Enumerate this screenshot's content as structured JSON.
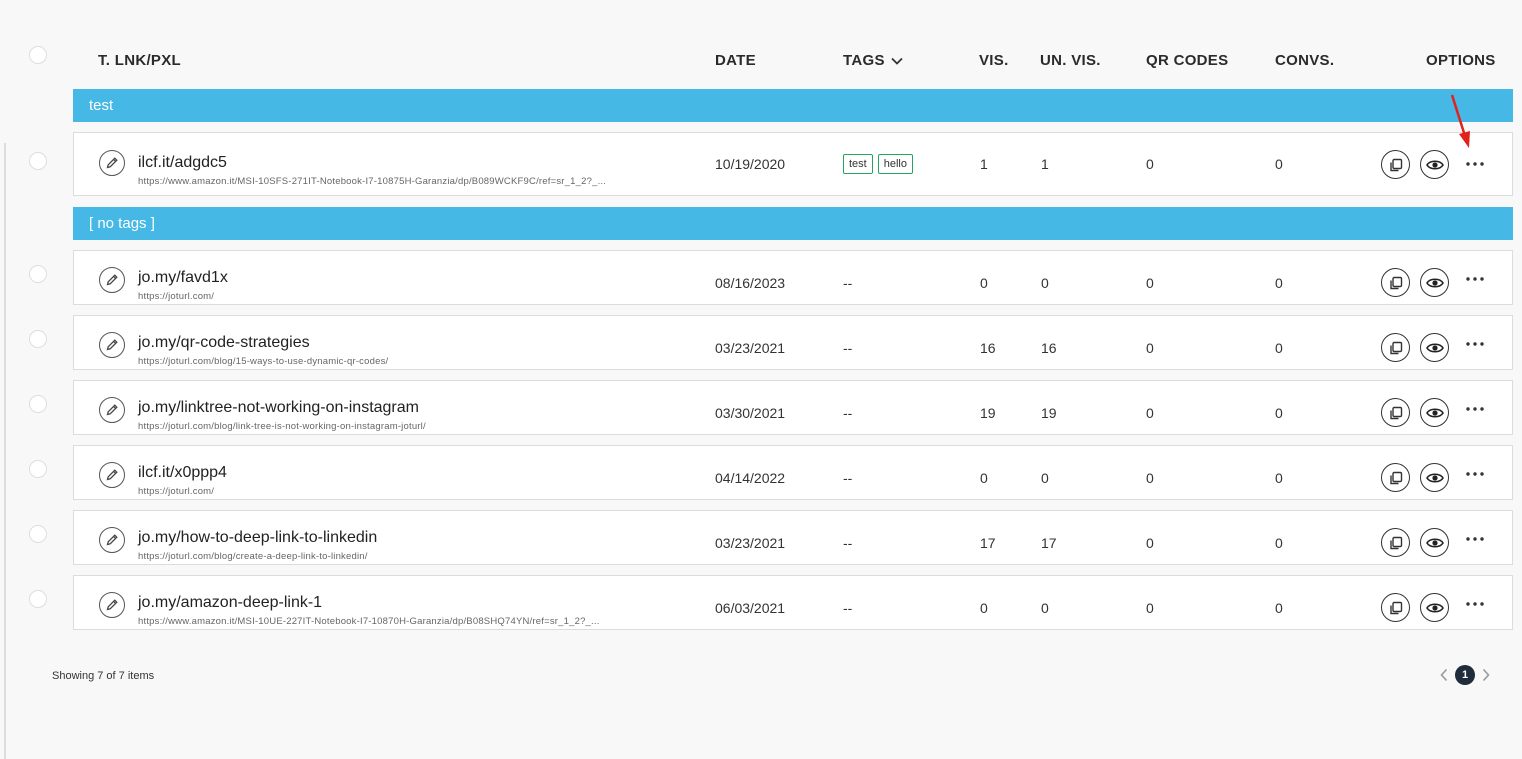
{
  "columns": {
    "link": "T. LNK/PXL",
    "date": "DATE",
    "tags": "TAGS",
    "visits": "VIS.",
    "unique_visits": "UN. VIS.",
    "qr_codes": "QR CODES",
    "conversions": "CONVS.",
    "options": "OPTIONS"
  },
  "groups": [
    {
      "label": "test",
      "rows": [
        {
          "name": "ilcf.it/adgdc5",
          "url": "https://www.amazon.it/MSI-10SFS-271IT-Notebook-I7-10875H-Garanzia/dp/B089WCKF9C/ref=sr_1_2?_...",
          "date": "10/19/2020",
          "tags": [
            "test",
            "hello"
          ],
          "tags_text": "",
          "vis": "1",
          "unvis": "1",
          "qr": "0",
          "conv": "0"
        }
      ]
    },
    {
      "label": "[ no tags ]",
      "rows": [
        {
          "name": "jo.my/favd1x",
          "url": "https://joturl.com/",
          "date": "08/16/2023",
          "tags_text": "--",
          "vis": "0",
          "unvis": "0",
          "qr": "0",
          "conv": "0"
        },
        {
          "name": "jo.my/qr-code-strategies",
          "url": "https://joturl.com/blog/15-ways-to-use-dynamic-qr-codes/",
          "date": "03/23/2021",
          "tags_text": "--",
          "vis": "16",
          "unvis": "16",
          "qr": "0",
          "conv": "0"
        },
        {
          "name": "jo.my/linktree-not-working-on-instagram",
          "url": "https://joturl.com/blog/link-tree-is-not-working-on-instagram-joturl/",
          "date": "03/30/2021",
          "tags_text": "--",
          "vis": "19",
          "unvis": "19",
          "qr": "0",
          "conv": "0"
        },
        {
          "name": "ilcf.it/x0ppp4",
          "url": "https://joturl.com/",
          "date": "04/14/2022",
          "tags_text": "--",
          "vis": "0",
          "unvis": "0",
          "qr": "0",
          "conv": "0"
        },
        {
          "name": "jo.my/how-to-deep-link-to-linkedin",
          "url": "https://joturl.com/blog/create-a-deep-link-to-linkedin/",
          "date": "03/23/2021",
          "tags_text": "--",
          "vis": "17",
          "unvis": "17",
          "qr": "0",
          "conv": "0"
        },
        {
          "name": "jo.my/amazon-deep-link-1",
          "url": "https://www.amazon.it/MSI-10UE-227IT-Notebook-I7-10870H-Garanzia/dp/B08SHQ74YN/ref=sr_1_2?_...",
          "date": "06/03/2021",
          "tags_text": "--",
          "vis": "0",
          "unvis": "0",
          "qr": "0",
          "conv": "0"
        }
      ]
    }
  ],
  "footer": {
    "showing": "Showing 7 of 7 items",
    "current_page": "1"
  },
  "colors": {
    "group_bar": "#45b8e6",
    "tag_border": "#2aa361",
    "annotation_arrow": "#e0221b"
  },
  "icons": [
    "note-icon",
    "edit-icon",
    "copy-icon",
    "eye-icon",
    "more-options-icon",
    "chevron-down-icon",
    "chevron-left-icon",
    "chevron-right-icon"
  ]
}
